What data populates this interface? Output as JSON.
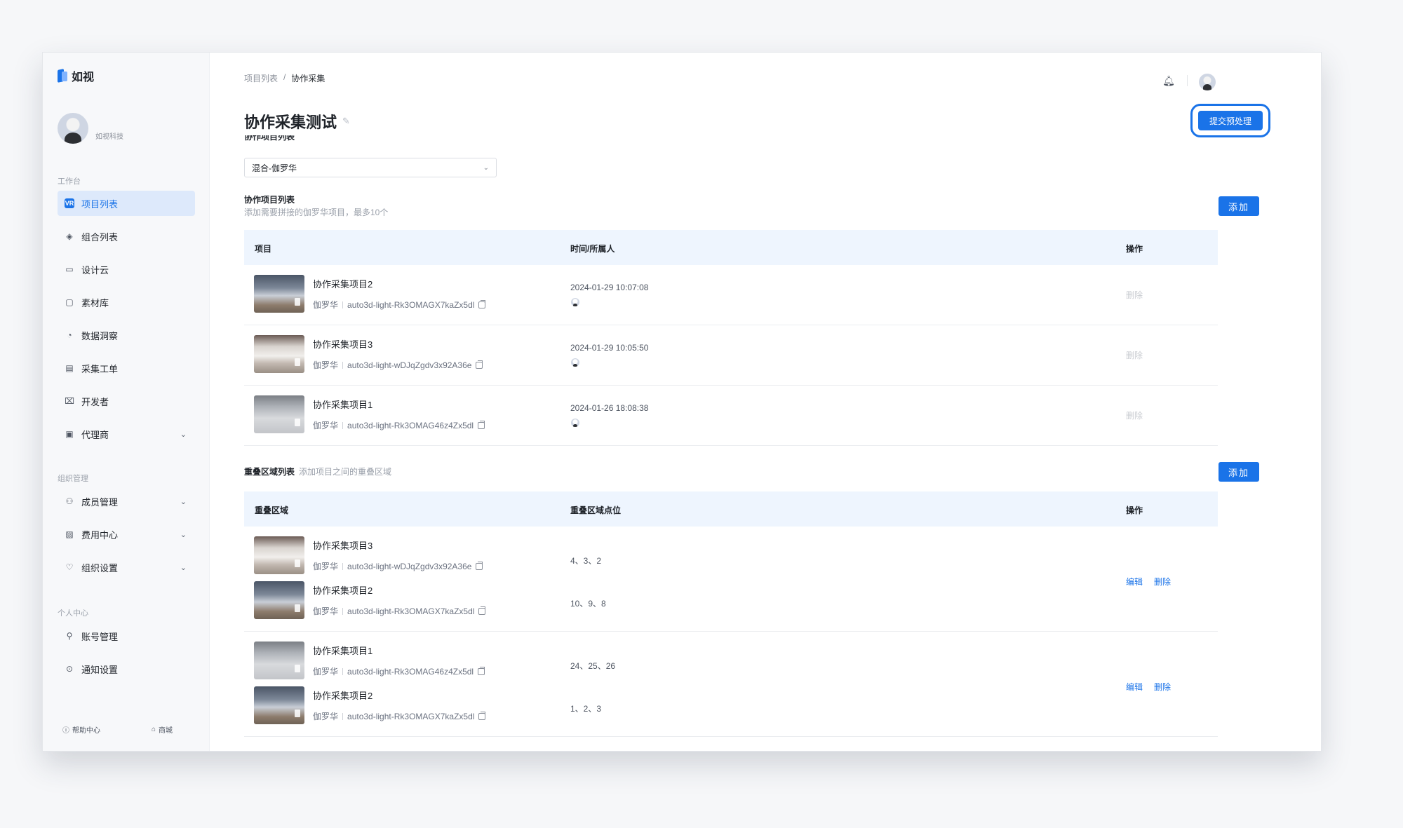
{
  "brand": {
    "name": "如视"
  },
  "org": {
    "name": "如视科技"
  },
  "sidebar": {
    "group_workbench": "工作台",
    "group_org": "组织管理",
    "group_personal": "个人中心",
    "items": [
      {
        "label": "项目列表",
        "icon": "vr-icon",
        "active": true
      },
      {
        "label": "组合列表",
        "icon": "layers-icon"
      },
      {
        "label": "设计云",
        "icon": "monitor-icon"
      },
      {
        "label": "素材库",
        "icon": "folder-icon"
      },
      {
        "label": "数据洞察",
        "icon": "pie-chart-icon"
      },
      {
        "label": "采集工单",
        "icon": "document-icon"
      },
      {
        "label": "开发者",
        "icon": "code-icon"
      },
      {
        "label": "代理商",
        "icon": "briefcase-icon",
        "expandable": true
      },
      {
        "label": "成员管理",
        "icon": "members-icon",
        "expandable": true
      },
      {
        "label": "费用中心",
        "icon": "wallet-icon",
        "expandable": true
      },
      {
        "label": "组织设置",
        "icon": "shield-icon",
        "expandable": true
      },
      {
        "label": "账号管理",
        "icon": "user-icon"
      },
      {
        "label": "通知设置",
        "icon": "settings-icon"
      }
    ],
    "footer": {
      "help": "帮助中心",
      "shop": "商城"
    }
  },
  "header": {
    "breadcrumb": [
      "项目列表",
      "协作采集"
    ],
    "breadcrumb_sep": "/",
    "title": "协作采集测试",
    "submit_label": "提交预处理"
  },
  "collab_section": {
    "clipped_label": "协作项目列表",
    "select_value": "混合-伽罗华",
    "title": "协作项目列表",
    "subtitle": "添加需要拼接的伽罗华项目，最多10个",
    "add_label": "添加",
    "columns": [
      "项目",
      "时间/所属人",
      "操作"
    ],
    "rows": [
      {
        "name": "协作采集项目2",
        "type": "伽罗华",
        "code": "auto3d-light-Rk3OMAGX7kaZx5dl",
        "time": "2024-01-29 10:07:08",
        "action": "删除",
        "thumb": "a"
      },
      {
        "name": "协作采集项目3",
        "type": "伽罗华",
        "code": "auto3d-light-wDJqZgdv3x92A36e",
        "time": "2024-01-29 10:05:50",
        "action": "删除",
        "thumb": "b"
      },
      {
        "name": "协作采集项目1",
        "type": "伽罗华",
        "code": "auto3d-light-Rk3OMAG46z4Zx5dl",
        "time": "2024-01-26 18:08:38",
        "action": "删除",
        "thumb": "c"
      }
    ]
  },
  "overlap_section": {
    "title": "重叠区域列表",
    "subtitle": "添加项目之间的重叠区域",
    "add_label": "添加",
    "columns": [
      "重叠区域",
      "重叠区域点位",
      "操作"
    ],
    "groups": [
      {
        "items": [
          {
            "name": "协作采集项目3",
            "type": "伽罗华",
            "code": "auto3d-light-wDJqZgdv3x92A36e",
            "points": "4、3、2",
            "thumb": "b"
          },
          {
            "name": "协作采集项目2",
            "type": "伽罗华",
            "code": "auto3d-light-Rk3OMAGX7kaZx5dl",
            "points": "10、9、8",
            "thumb": "a"
          }
        ],
        "edit": "编辑",
        "delete": "删除"
      },
      {
        "items": [
          {
            "name": "协作采集项目1",
            "type": "伽罗华",
            "code": "auto3d-light-Rk3OMAG46z4Zx5dl",
            "points": "24、25、26",
            "thumb": "c"
          },
          {
            "name": "协作采集项目2",
            "type": "伽罗华",
            "code": "auto3d-light-Rk3OMAGX7kaZx5dl",
            "points": "1、2、3",
            "thumb": "a"
          }
        ],
        "edit": "编辑",
        "delete": "删除"
      }
    ]
  },
  "colors": {
    "accent": "#1a73e8",
    "active_bg": "#dde9fb",
    "table_head_bg": "#eef5fe"
  }
}
